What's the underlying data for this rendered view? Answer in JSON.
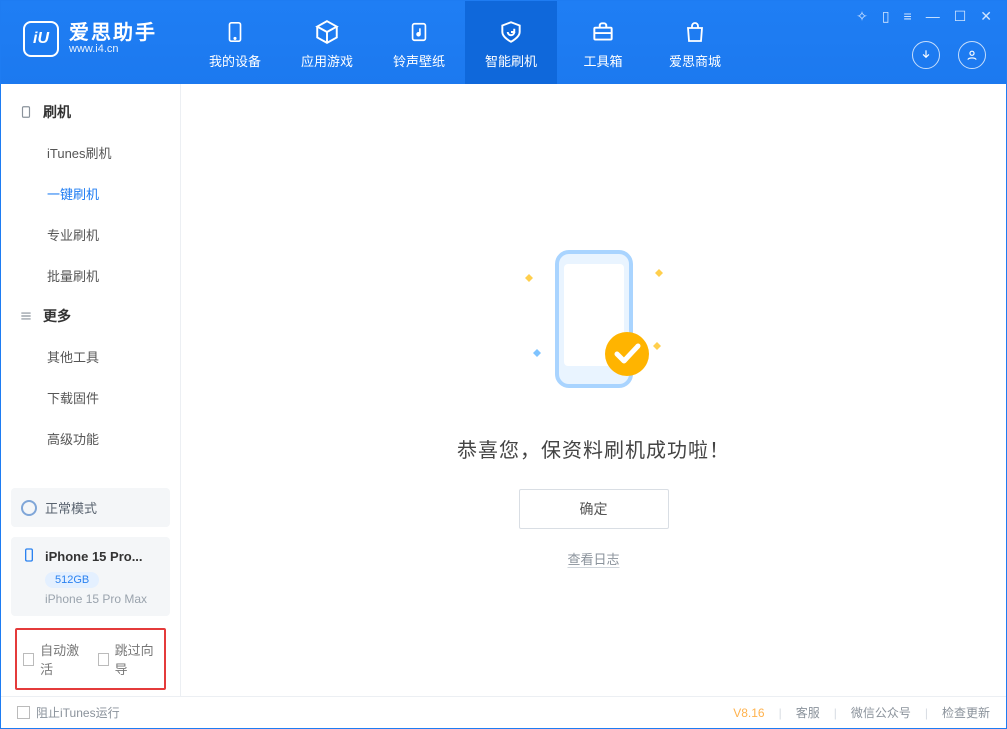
{
  "app": {
    "title_cn": "爱思助手",
    "title_en": "www.i4.cn"
  },
  "tabs": [
    {
      "label": "我的设备"
    },
    {
      "label": "应用游戏"
    },
    {
      "label": "铃声壁纸"
    },
    {
      "label": "智能刷机"
    },
    {
      "label": "工具箱"
    },
    {
      "label": "爱思商城"
    }
  ],
  "sidebar": {
    "group1": {
      "title": "刷机",
      "items": [
        "iTunes刷机",
        "一键刷机",
        "专业刷机",
        "批量刷机"
      ],
      "active_index": 1
    },
    "group2": {
      "title": "更多",
      "items": [
        "其他工具",
        "下载固件",
        "高级功能"
      ]
    }
  },
  "mode_card": {
    "label": "正常模式"
  },
  "device": {
    "name": "iPhone 15 Pro...",
    "storage": "512GB",
    "model": "iPhone 15 Pro Max"
  },
  "checks": {
    "auto_activate": "自动激活",
    "skip_guide": "跳过向导"
  },
  "main": {
    "message": "恭喜您，保资料刷机成功啦！",
    "ok": "确定",
    "view_log": "查看日志"
  },
  "footer": {
    "block_itunes": "阻止iTunes运行",
    "version": "V8.16",
    "links": [
      "客服",
      "微信公众号",
      "检查更新"
    ]
  }
}
